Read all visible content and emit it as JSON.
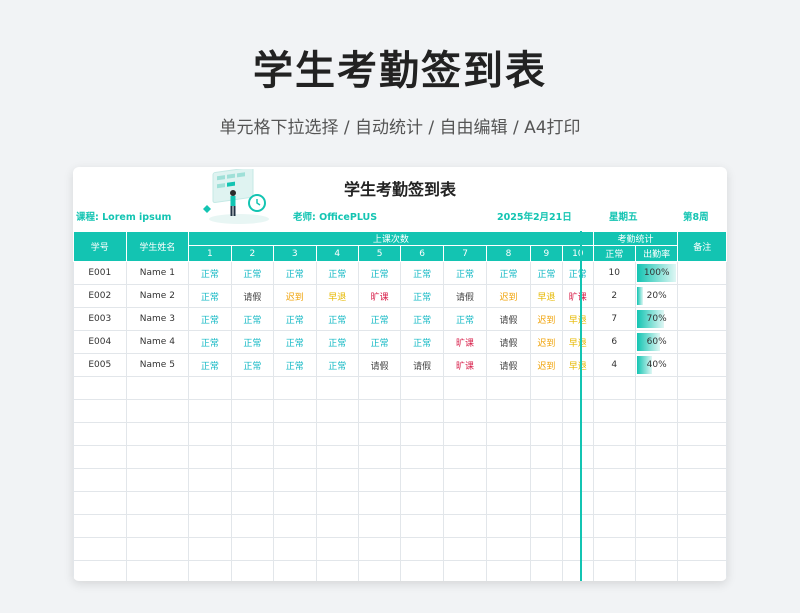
{
  "hero": {
    "title": "学生考勤签到表",
    "subtitle": "单元格下拉选择 / 自动统计 / 自由编辑 / A4打印"
  },
  "sheet": {
    "title": "学生考勤签到表",
    "course_label": "课程:",
    "course_value": "Lorem ipsum",
    "teacher_label": "老师:",
    "teacher_value": "OfficePLUS",
    "date": "2025年2月21日",
    "weekday": "星期五",
    "week": "第8周"
  },
  "headers": {
    "id": "学号",
    "name": "学生姓名",
    "sessions": "上课次数",
    "stats": "考勤统计",
    "remark": "备注",
    "normal": "正常",
    "rate": "出勤率",
    "session_numbers": [
      "1",
      "2",
      "3",
      "4",
      "5",
      "6",
      "7",
      "8",
      "9",
      "10"
    ]
  },
  "rows": [
    {
      "id": "E001",
      "name": "Name 1",
      "marks": [
        "正常",
        "正常",
        "正常",
        "正常",
        "正常",
        "正常",
        "正常",
        "正常",
        "正常",
        "正常"
      ],
      "normal": "10",
      "rate": "100%",
      "rate_value": 1.0
    },
    {
      "id": "E002",
      "name": "Name 2",
      "marks": [
        "正常",
        "请假",
        "迟到",
        "早退",
        "旷课",
        "正常",
        "请假",
        "迟到",
        "早退",
        "旷课"
      ],
      "normal": "2",
      "rate": "20%",
      "rate_value": 0.2
    },
    {
      "id": "E003",
      "name": "Name 3",
      "marks": [
        "正常",
        "正常",
        "正常",
        "正常",
        "正常",
        "正常",
        "正常",
        "请假",
        "迟到",
        "早退"
      ],
      "normal": "7",
      "rate": "70%",
      "rate_value": 0.7
    },
    {
      "id": "E004",
      "name": "Name 4",
      "marks": [
        "正常",
        "正常",
        "正常",
        "正常",
        "正常",
        "正常",
        "旷课",
        "请假",
        "迟到",
        "早退"
      ],
      "normal": "6",
      "rate": "60%",
      "rate_value": 0.6
    },
    {
      "id": "E005",
      "name": "Name 5",
      "marks": [
        "正常",
        "正常",
        "正常",
        "正常",
        "请假",
        "请假",
        "旷课",
        "请假",
        "迟到",
        "早退"
      ],
      "normal": "4",
      "rate": "40%",
      "rate_value": 0.4
    }
  ],
  "empty_rows": 9,
  "colors": {
    "accent": "#13c4b2",
    "正常": "#13b8c4",
    "请假": "#444444",
    "迟到": "#f0a30a",
    "早退": "#e6b800",
    "旷课": "#d9254f"
  }
}
